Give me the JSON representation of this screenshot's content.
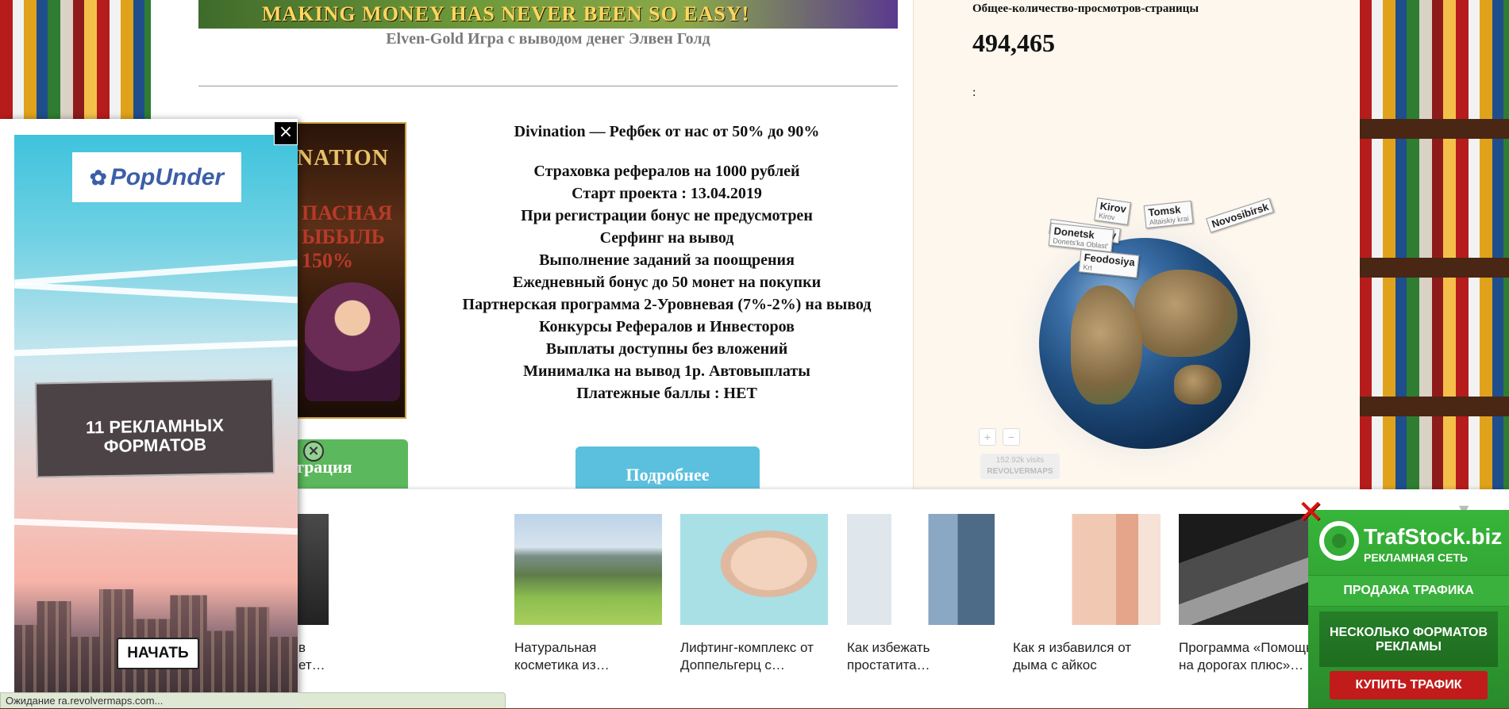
{
  "top_banner": {
    "text": "MAKING MONEY HAS NEVER BEEN SO EASY!"
  },
  "post": {
    "caption": "Elven-Gold Игра с выводом денег Элвен Голд",
    "game_image": {
      "title": "NATION",
      "promo_line1": "ПАСНАЯ",
      "promo_line2": "ЫБЫЛЬ",
      "promo_line3": "150%"
    },
    "project_title": "Divination — Рефбек от нас от 50% до 90%",
    "features": [
      "Страховка рефералов на 1000 рублей",
      "Старт проекта : 13.04.2019",
      "При регистрации бонус не предусмотрен",
      "Серфинг на вывод",
      "Выполнение заданий за поощрения",
      "Ежедневный бонус до 50 монет на покупки",
      "Партнерская программа 2-Уровневая (7%-2%) на вывод",
      "Конкурсы Рефералов и Инвесторов",
      "Выплаты доступны без вложений",
      "Минималка на вывод 1р. Автовыплаты",
      "Платежные баллы : НЕТ"
    ],
    "register_button": "трация",
    "more_button": "Подробнее"
  },
  "sidebar": {
    "views_label": "Общее-количество-просмотров-страницы",
    "views_count": "494,465",
    "dots": ":",
    "map_tags": [
      {
        "city": "Kirov",
        "region": "Kirov"
      },
      {
        "city": "Tomsk",
        "region": "Altaiskiy krai"
      },
      {
        "city": "Donetsk",
        "region": "Donets'ka Oblast'"
      },
      {
        "city": "Feodosiya",
        "region": "Krt"
      },
      {
        "city": "Moscow City",
        "region": ""
      },
      {
        "city": "Novosibirsk",
        "region": ""
      }
    ],
    "zoom_in": "+",
    "zoom_out": "−",
    "visits": "152.92k visits",
    "revolvermaps": "REVOLVERMAPS"
  },
  "ad_strip": {
    "cards": [
      {
        "text": "в\nет…"
      },
      {
        "text": "Натуральная косметика из…"
      },
      {
        "text": "Лифтинг-комплекс от Доппельгерц с…"
      },
      {
        "text": "Как избежать простатита…"
      },
      {
        "text": "Как я избавился от дыма с айкос"
      },
      {
        "text": "Программа «Помощь на дорогах плюс»…"
      }
    ],
    "chevron": "▼"
  },
  "popunder": {
    "logo": "PopUnder",
    "headline": "11 РЕКЛАМНЫХ ФОРМАТОВ",
    "start_button": "НАЧАТЬ",
    "close": "×"
  },
  "trafstock": {
    "name": "TrafStock.biz",
    "network": "РЕКЛАМНАЯ СЕТЬ",
    "sale": "ПРОДАЖА ТРАФИКА",
    "formats": "НЕСКОЛЬКО ФОРМАТОВ РЕКЛАМЫ",
    "buy": "КУПИТЬ ТРАФИК",
    "close": "✕"
  },
  "statusbar": {
    "text": "Ожидание ra.revolvermaps.com..."
  }
}
